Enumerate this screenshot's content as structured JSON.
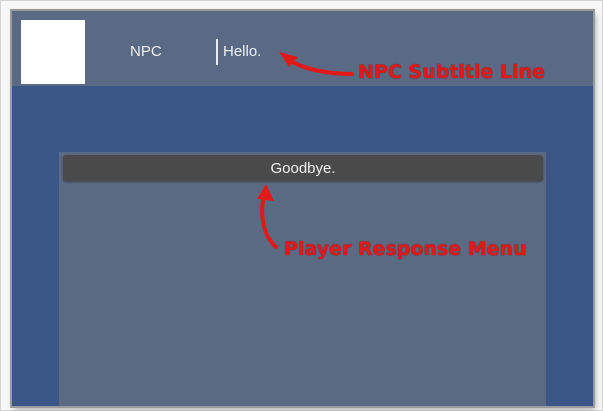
{
  "subtitle_panel": {
    "npc_name": "NPC",
    "line": "Hello."
  },
  "response_menu": {
    "responses": [
      "Goodbye."
    ]
  },
  "annotations": {
    "npc_subtitle_label": "NPC Subtitle Line",
    "player_response_label": "Player Response Menu",
    "color": "#e11919"
  },
  "colors": {
    "background": "#3b5787",
    "subtitle_bar": "#5a6a84",
    "response_panel": "#5b6a83",
    "response_button": "#4a4a4a"
  }
}
